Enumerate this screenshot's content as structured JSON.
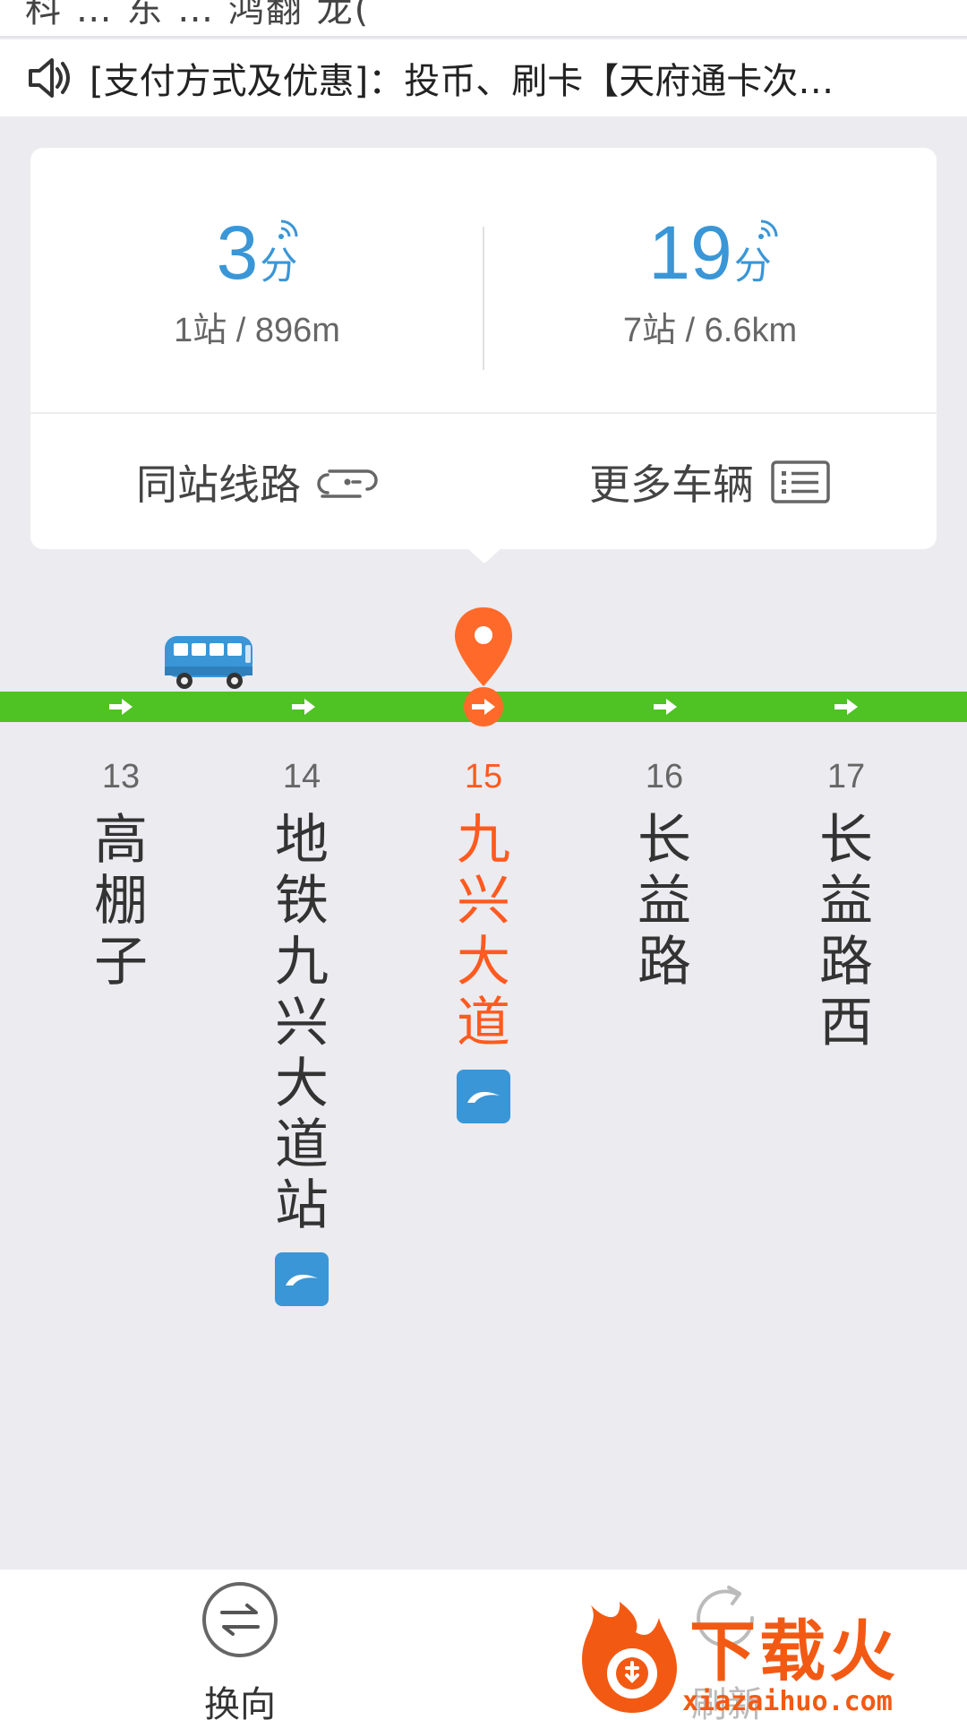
{
  "top_strip": {
    "partial_text": "科 … 东 … 鸿翻 龙("
  },
  "notice": {
    "text": "[支付方式及优惠]：投币、刷卡【天府通卡次…"
  },
  "eta": [
    {
      "minutes": "3",
      "unit": "分",
      "detail": "1站 / 896m"
    },
    {
      "minutes": "19",
      "unit": "分",
      "detail": "7站 / 6.6km"
    }
  ],
  "links": {
    "same_station": "同站线路",
    "more_vehicles": "更多车辆"
  },
  "stops": [
    {
      "index": "13",
      "name": "高棚子",
      "metro": false,
      "current": false
    },
    {
      "index": "14",
      "name": "地铁九兴大道站",
      "metro": true,
      "current": false
    },
    {
      "index": "15",
      "name": "九兴大道",
      "metro": true,
      "current": true
    },
    {
      "index": "16",
      "name": "长益路",
      "metro": false,
      "current": false
    },
    {
      "index": "17",
      "name": "长益路西",
      "metro": false,
      "current": false
    }
  ],
  "bottom": {
    "swap_label": "换向",
    "refresh_label": "刷新"
  },
  "watermark": {
    "text": "下载火",
    "url": "xiazaihuo.com"
  },
  "colors": {
    "accent_blue": "#3a96d6",
    "track_green": "#4fc224",
    "current_orange": "#ff5a1f"
  }
}
